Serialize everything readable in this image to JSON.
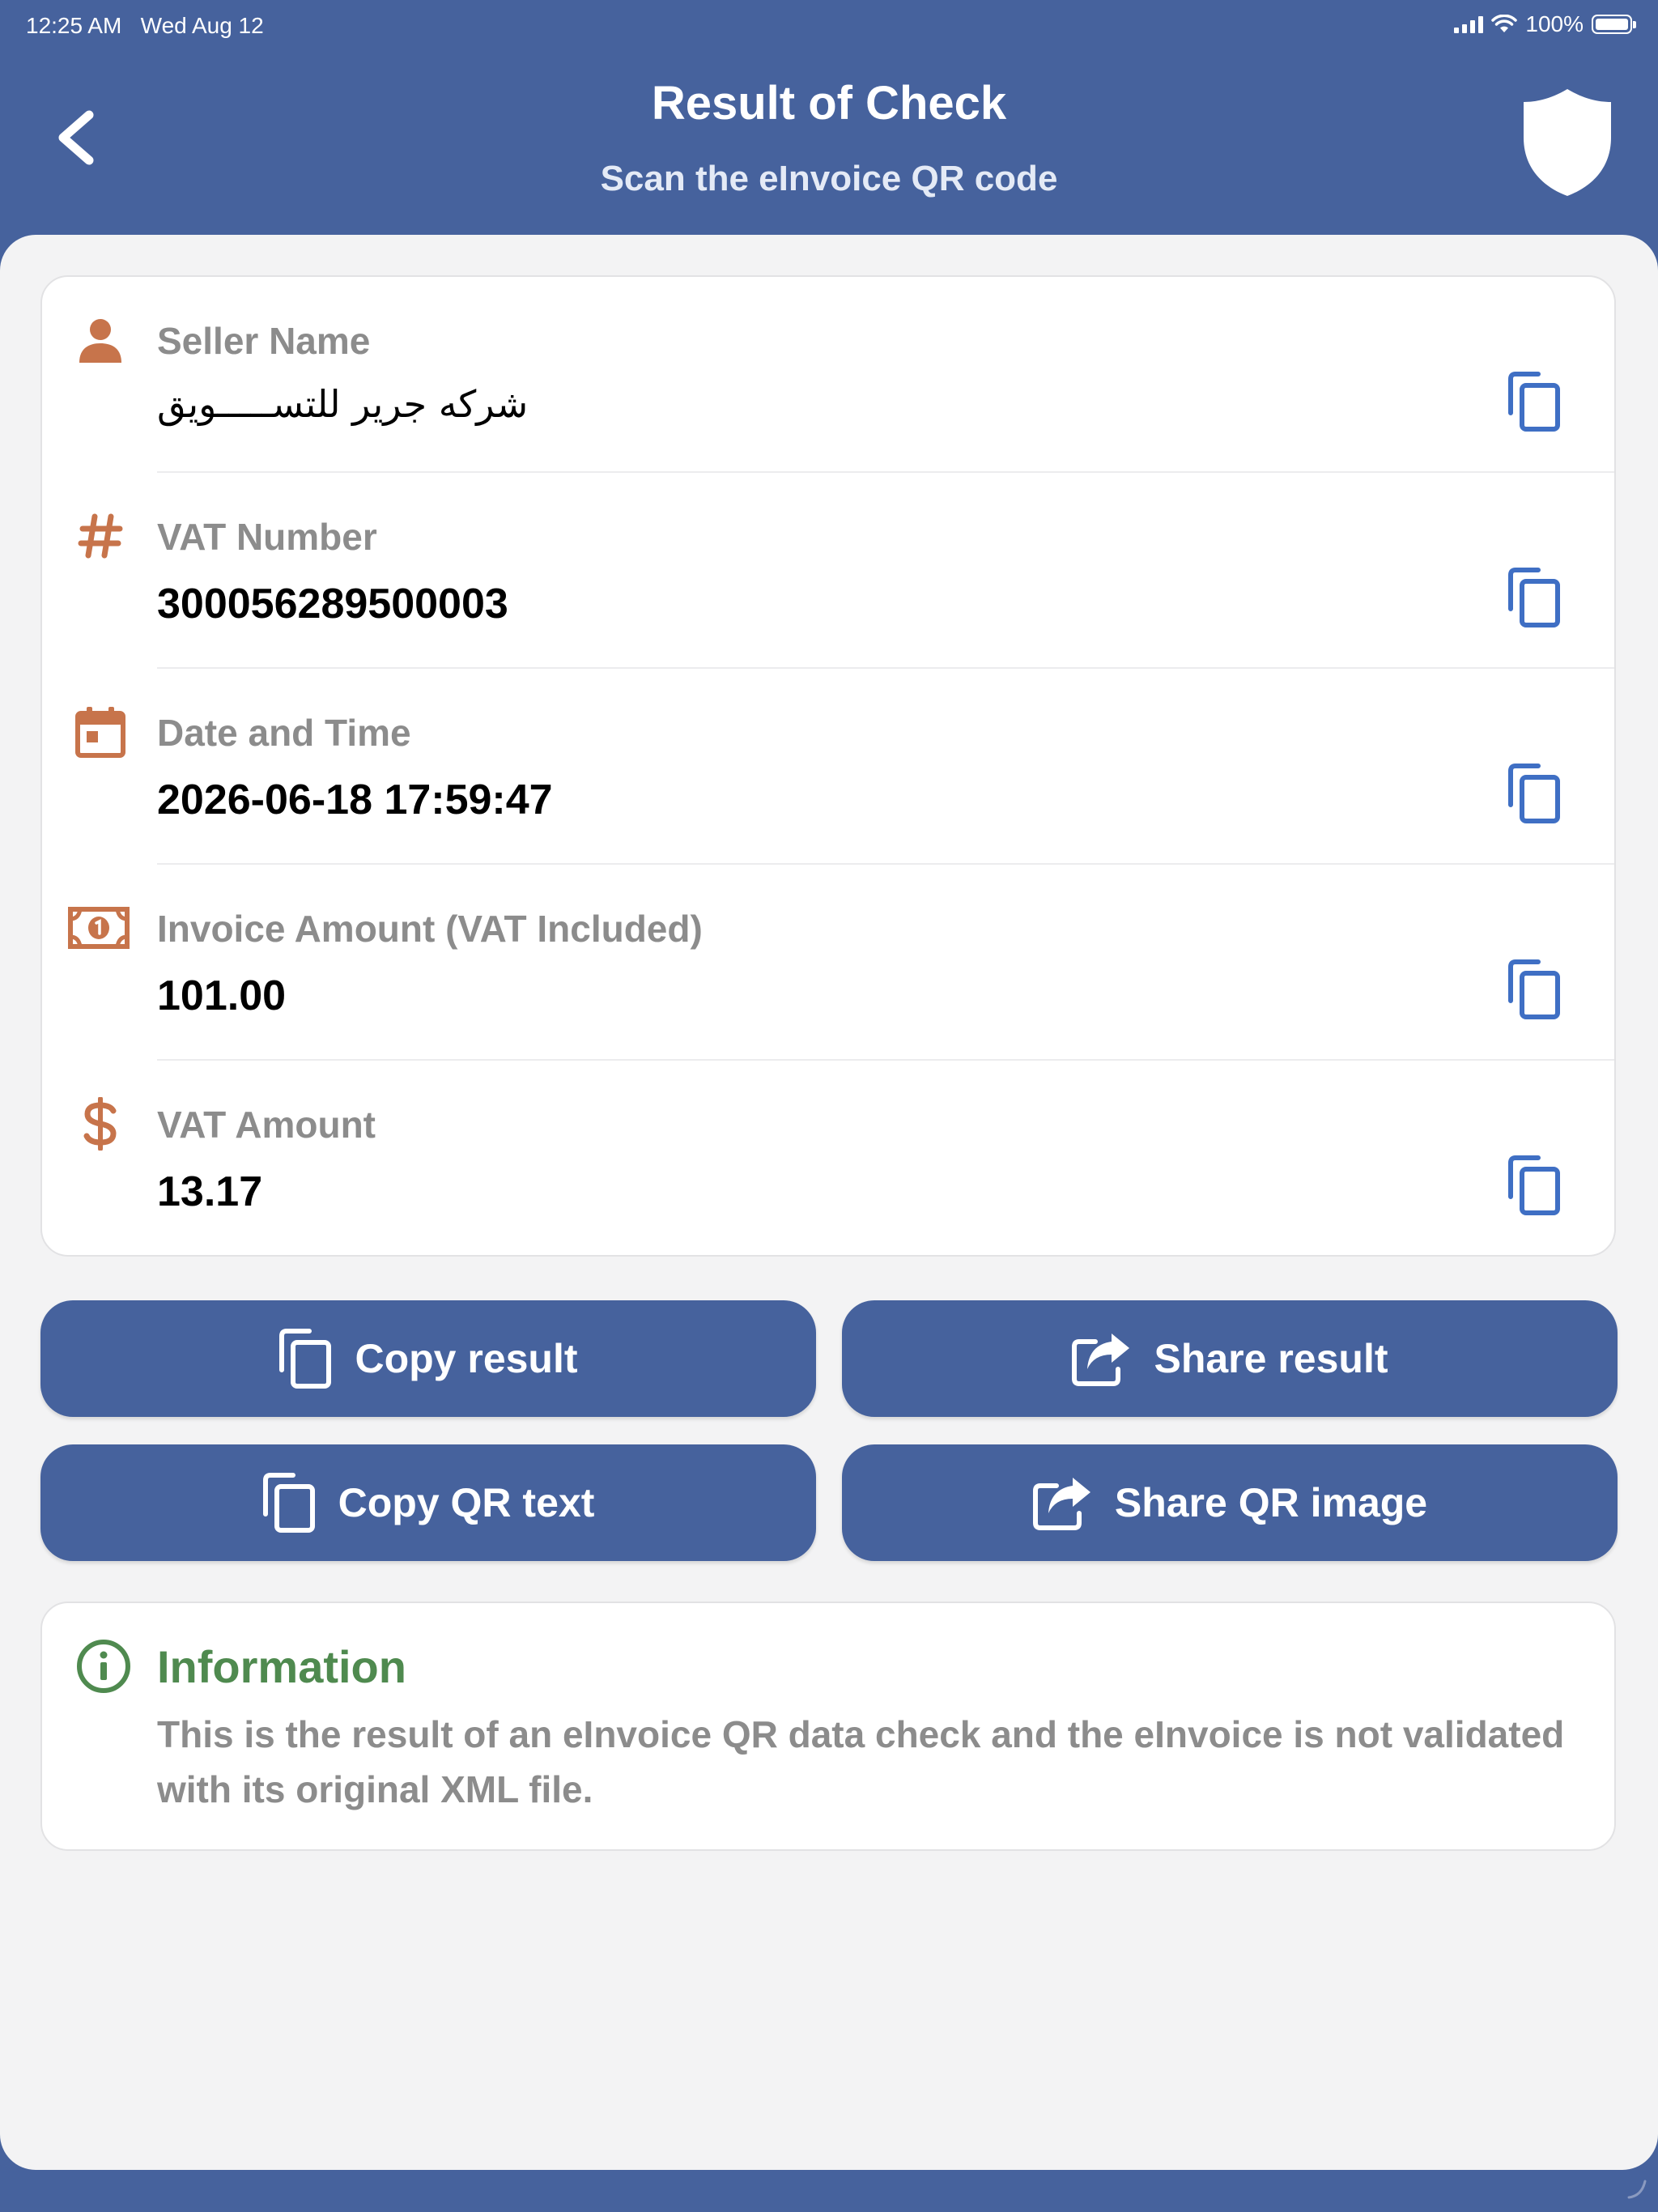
{
  "status_bar": {
    "time": "12:25 AM",
    "date": "Wed Aug 12",
    "battery": "100%"
  },
  "header": {
    "title": "Result of Check",
    "subtitle": "Scan the eInvoice QR code"
  },
  "results": [
    {
      "label": "Seller Name",
      "value": "شركه جرير للتســـــويق",
      "icon": "person-icon"
    },
    {
      "label": "VAT Number",
      "value": "300056289500003",
      "icon": "hash-icon"
    },
    {
      "label": "Date and Time",
      "value": "2026-06-18 17:59:47",
      "icon": "calendar-icon"
    },
    {
      "label": "Invoice Amount (VAT Included)",
      "value": "101.00",
      "icon": "money-bill-icon"
    },
    {
      "label": "VAT Amount",
      "value": "13.17",
      "icon": "dollar-icon"
    }
  ],
  "actions": {
    "copy_result": "Copy result",
    "share_result": "Share result",
    "copy_qr_text": "Copy QR text",
    "share_qr_image": "Share QR image"
  },
  "info": {
    "title": "Information",
    "text": "This is the result of an eInvoice QR data check and the eInvoice is not validated with its original XML file."
  },
  "colors": {
    "primary": "#46629d",
    "icon_accent": "#c7744b",
    "copy_icon": "#3f6fc4",
    "info_title": "#4f8a4f",
    "label_gray": "#8c8c8c",
    "panel_background": "#f3f3f4"
  }
}
